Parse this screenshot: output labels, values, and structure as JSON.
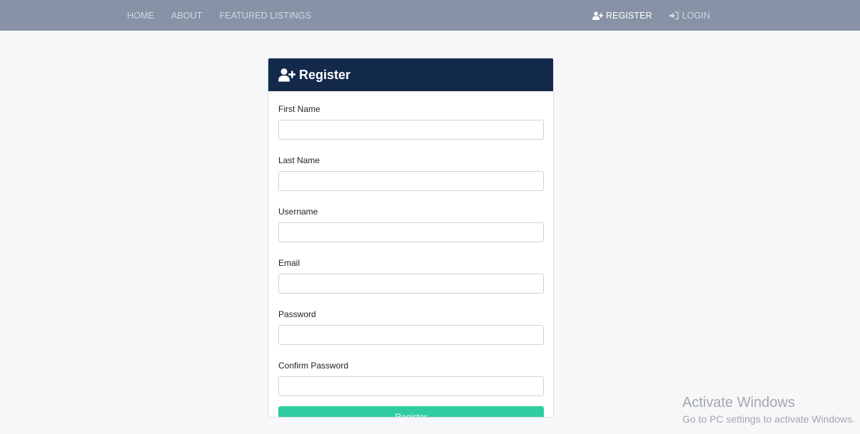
{
  "nav": {
    "links": [
      {
        "label": "HOME"
      },
      {
        "label": "ABOUT"
      },
      {
        "label": "FEATURED LISTINGS"
      }
    ],
    "register_label": "REGISTER",
    "login_label": "LOGIN",
    "register_icon": "user-plus-icon",
    "login_icon": "sign-in-icon"
  },
  "card": {
    "title": "Register",
    "title_icon": "user-plus-icon",
    "fields": [
      {
        "label": "First Name",
        "value": ""
      },
      {
        "label": "Last Name",
        "value": ""
      },
      {
        "label": "Username",
        "value": ""
      },
      {
        "label": "Email",
        "value": ""
      },
      {
        "label": "Password",
        "value": ""
      },
      {
        "label": "Confirm Password",
        "value": ""
      }
    ],
    "submit_label": "Register"
  },
  "watermark": {
    "title": "Activate Windows",
    "subtitle": "Go to PC settings to activate Windows."
  },
  "colors": {
    "navbar": "#8792a6",
    "card_header": "#13294b",
    "submit": "#2ecc9f",
    "page_bg": "#f6f7f9"
  }
}
